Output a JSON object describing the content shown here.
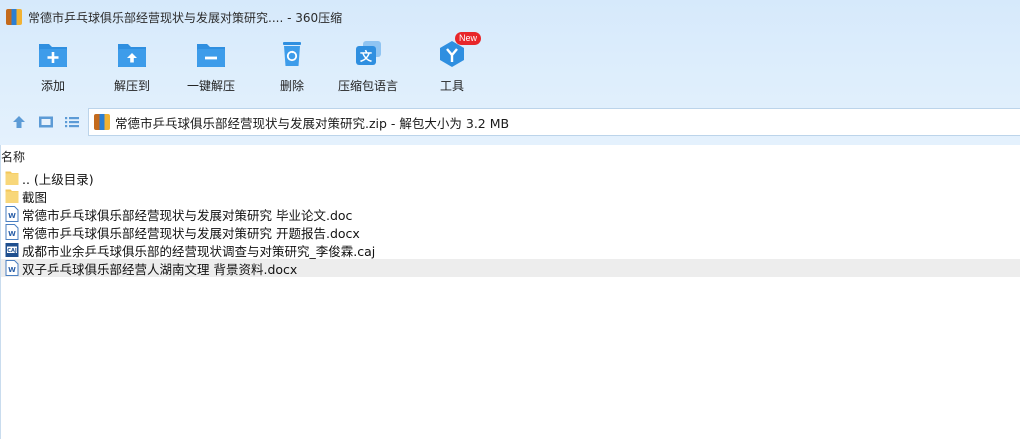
{
  "window": {
    "title": "常德市乒乓球俱乐部经营现状与发展对策研究.... - 360压缩"
  },
  "toolbar": {
    "buttons": [
      {
        "label": "添加",
        "icon": "add-folder-icon"
      },
      {
        "label": "解压到",
        "icon": "extract-to-icon"
      },
      {
        "label": "一键解压",
        "icon": "one-click-extract-icon"
      },
      {
        "label": "删除",
        "icon": "trash-icon"
      },
      {
        "label": "压缩包语言",
        "icon": "language-icon"
      },
      {
        "label": "工具",
        "icon": "tools-icon",
        "badge": "New"
      }
    ]
  },
  "nav": {
    "path": "常德市乒乓球俱乐部经营现状与发展对策研究.zip - 解包大小为 3.2 MB"
  },
  "list": {
    "column_name": "名称",
    "items": [
      {
        "name": ".. (上级目录)",
        "type": "folder"
      },
      {
        "name": "截图",
        "type": "folder"
      },
      {
        "name": "常德市乒乓球俱乐部经营现状与发展对策研究 毕业论文.doc",
        "type": "doc"
      },
      {
        "name": "常德市乒乓球俱乐部经营现状与发展对策研究 开题报告.docx",
        "type": "docx"
      },
      {
        "name": "成都市业余乒乓球俱乐部的经营现状调查与对策研究_李俊霖.caj",
        "type": "caj"
      },
      {
        "name": "双子乒乓球俱乐部经营人湖南文理 背景资料.docx",
        "type": "docx",
        "selected": true
      }
    ]
  },
  "colors": {
    "accent": "#2f8fe0",
    "header_bg": "#d9ebfc",
    "selection": "#ededed"
  }
}
